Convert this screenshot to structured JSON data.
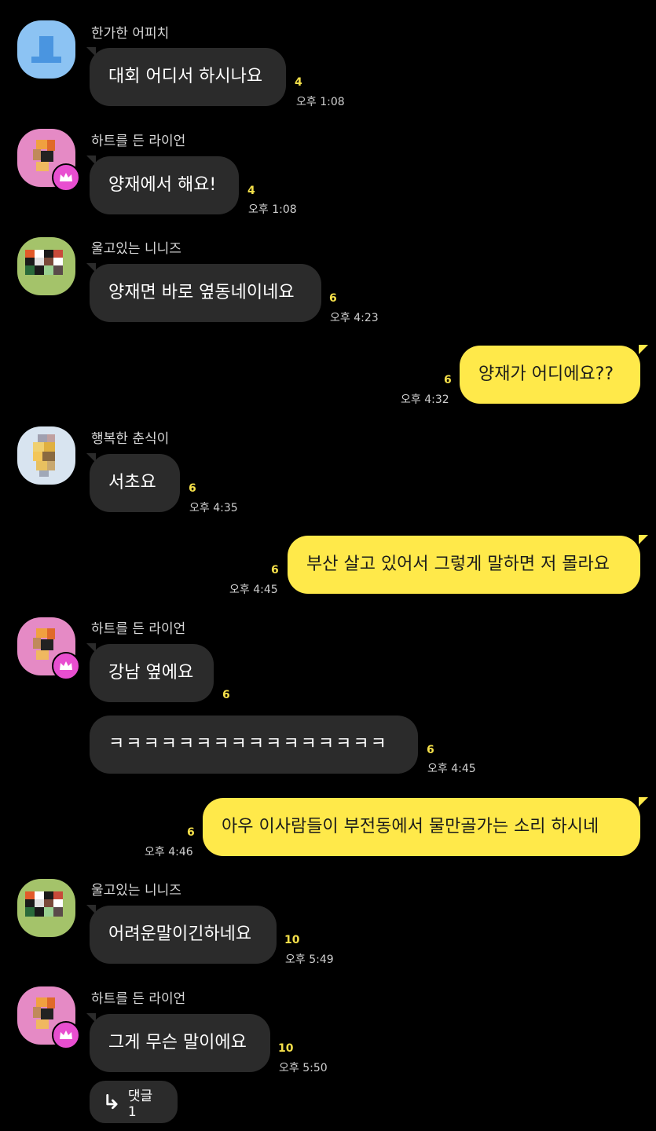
{
  "colors": {
    "background": "#000000",
    "other_bubble": "#2b2b2b",
    "my_bubble": "#ffe94a",
    "unread_count": "#f5e04a",
    "crown_badge": "#e84ed0"
  },
  "messages": [
    {
      "sender": "한가한 어피치",
      "text": "대회 어디서 하시나요",
      "unread": "4",
      "time": "오후 1:08"
    },
    {
      "sender": "하트를 든 라이언",
      "text": "양재에서 해요!",
      "unread": "4",
      "time": "오후 1:08"
    },
    {
      "sender": "울고있는 니니즈",
      "text": "양재면 바로 옆동네이네요",
      "unread": "6",
      "time": "오후 4:23"
    },
    {
      "sender": "",
      "text": "양재가 어디에요??",
      "unread": "6",
      "time": "오후 4:32"
    },
    {
      "sender": "행복한 춘식이",
      "text": "서초요",
      "unread": "6",
      "time": "오후 4:35"
    },
    {
      "sender": "",
      "text": "부산 살고 있어서 그렇게 말하면 저 몰라요",
      "unread": "6",
      "time": "오후 4:45"
    },
    {
      "sender": "하트를 든 라이언",
      "text": "강남 옆에요",
      "unread": "6",
      "time": ""
    },
    {
      "sender": "",
      "text": "ㅋㅋㅋㅋㅋㅋㅋㅋㅋㅋㅋㅋㅋㅋㅋㅋ",
      "unread": "6",
      "time": "오후 4:45"
    },
    {
      "sender": "",
      "text": "아우 이사람들이 부전동에서 물만골가는 소리 하시네",
      "unread": "6",
      "time": "오후 4:46"
    },
    {
      "sender": "울고있는 니니즈",
      "text": "어려운말이긴하네요",
      "unread": "10",
      "time": "오후 5:49"
    },
    {
      "sender": "하트를 든 라이언",
      "text": "그게 무슨 말이에요",
      "unread": "10",
      "time": "오후 5:50"
    }
  ],
  "reply_thread": {
    "icon": "reply-arrow-icon",
    "label": "댓글 1"
  },
  "icons": {
    "crown": "crown-icon",
    "default_profile": "person-icon"
  }
}
